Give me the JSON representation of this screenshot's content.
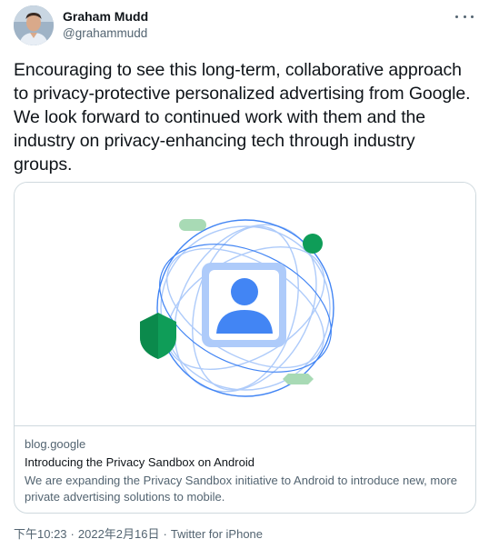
{
  "author": {
    "name": "Graham Mudd",
    "handle": "@grahammudd"
  },
  "tweet": {
    "text": "Encouraging to see this long-term, collaborative approach to privacy-protective personalized advertising from Google. We look forward to continued work with them and the industry on privacy-enhancing tech through industry groups."
  },
  "card": {
    "domain": "blog.google",
    "title": "Introducing the Privacy Sandbox on Android",
    "description": "We are expanding the Privacy Sandbox initiative to Android to introduce new, more private advertising solutions to mobile.",
    "illustration": {
      "icons": [
        "person-icon",
        "shield-icon"
      ],
      "colors": {
        "blue": "#4285f4",
        "light_blue": "#aecbfa",
        "green": "#0f9d58",
        "light_green": "#a8dab5"
      }
    }
  },
  "meta": {
    "time": "下午10:23",
    "separator": "·",
    "date": "2022年2月16日",
    "source": "Twitter for iPhone"
  }
}
